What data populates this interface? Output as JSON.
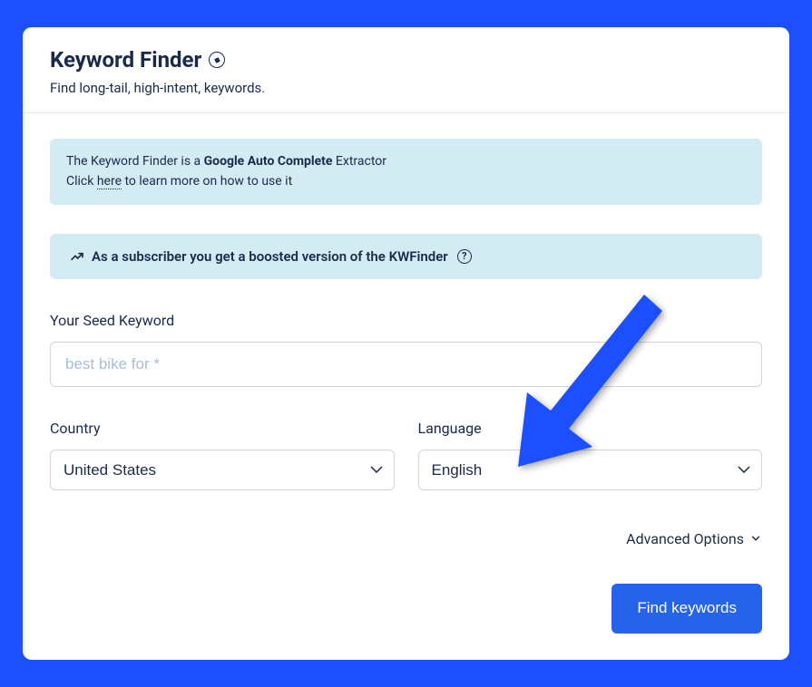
{
  "header": {
    "title": "Keyword Finder",
    "subtitle": "Find long-tail, high-intent, keywords."
  },
  "info_banner": {
    "prefix": "The Keyword Finder is a ",
    "bold": "Google Auto Complete",
    "suffix": " Extractor",
    "line2_prefix": "Click ",
    "here_link": "here",
    "line2_suffix": " to learn more on how to use it"
  },
  "subscriber_banner": {
    "text": "As a subscriber you get a boosted version of the KWFinder"
  },
  "form": {
    "seed_label": "Your Seed Keyword",
    "seed_placeholder": "best bike for *",
    "country_label": "Country",
    "country_value": "United States",
    "language_label": "Language",
    "language_value": "English",
    "advanced_label": "Advanced Options",
    "submit_label": "Find keywords"
  },
  "colors": {
    "background": "#1e4fff",
    "banner_bg": "#d3ecf4",
    "text_primary": "#1a2b4a",
    "button_bg": "#2563eb"
  }
}
